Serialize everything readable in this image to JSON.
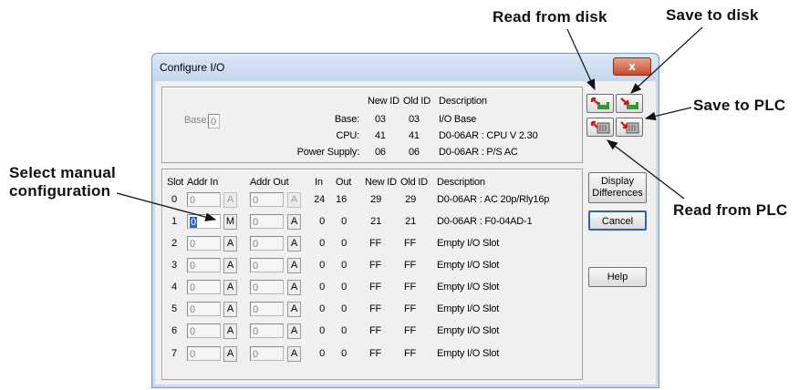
{
  "callouts": {
    "read_disk": "Read from disk",
    "save_disk": "Save to disk",
    "save_plc": "Save to PLC",
    "read_plc": "Read from PLC",
    "select_manual_1": "Select manual",
    "select_manual_2": "configuration"
  },
  "dialog": {
    "title": "Configure I/O",
    "close": "x",
    "base_label": "Base:",
    "base_value": "0",
    "header": {
      "new_id": "New ID",
      "old_id": "Old ID",
      "description": "Description"
    },
    "base_rows": [
      {
        "label": "Base:",
        "new_id": "03",
        "old_id": "03",
        "description": "I/O Base"
      },
      {
        "label": "CPU:",
        "new_id": "41",
        "old_id": "41",
        "description": "D0-06AR : CPU  V 2.30"
      },
      {
        "label": "Power Supply:",
        "new_id": "06",
        "old_id": "06",
        "description": "D0-06AR : P/S AC"
      }
    ],
    "slot_header": {
      "slot": "Slot",
      "addr_in": "Addr In",
      "addr_out": "Addr Out",
      "in": "In",
      "out": "Out",
      "new_id": "New ID",
      "old_id": "Old ID",
      "description": "Description"
    },
    "slots": [
      {
        "slot": "0",
        "addr_in": "0",
        "btn_in": "A",
        "addr_out": "0",
        "btn_out": "A",
        "in": "24",
        "out": "16",
        "new_id": "29",
        "old_id": "29",
        "description": "D0-06AR : AC 20p/Rly16p"
      },
      {
        "slot": "1",
        "addr_in": "0",
        "btn_in": "M",
        "addr_out": "0",
        "btn_out": "A",
        "in": "0",
        "out": "0",
        "new_id": "21",
        "old_id": "21",
        "description": "D0-06AR : F0-04AD-1"
      },
      {
        "slot": "2",
        "addr_in": "0",
        "btn_in": "A",
        "addr_out": "0",
        "btn_out": "A",
        "in": "0",
        "out": "0",
        "new_id": "FF",
        "old_id": "FF",
        "description": "Empty I/O Slot"
      },
      {
        "slot": "3",
        "addr_in": "0",
        "btn_in": "A",
        "addr_out": "0",
        "btn_out": "A",
        "in": "0",
        "out": "0",
        "new_id": "FF",
        "old_id": "FF",
        "description": "Empty I/O Slot"
      },
      {
        "slot": "4",
        "addr_in": "0",
        "btn_in": "A",
        "addr_out": "0",
        "btn_out": "A",
        "in": "0",
        "out": "0",
        "new_id": "FF",
        "old_id": "FF",
        "description": "Empty I/O Slot"
      },
      {
        "slot": "5",
        "addr_in": "0",
        "btn_in": "A",
        "addr_out": "0",
        "btn_out": "A",
        "in": "0",
        "out": "0",
        "new_id": "FF",
        "old_id": "FF",
        "description": "Empty I/O Slot"
      },
      {
        "slot": "6",
        "addr_in": "0",
        "btn_in": "A",
        "addr_out": "0",
        "btn_out": "A",
        "in": "0",
        "out": "0",
        "new_id": "FF",
        "old_id": "FF",
        "description": "Empty I/O Slot"
      },
      {
        "slot": "7",
        "addr_in": "0",
        "btn_in": "A",
        "addr_out": "0",
        "btn_out": "A",
        "in": "0",
        "out": "0",
        "new_id": "FF",
        "old_id": "FF",
        "description": "Empty I/O Slot"
      }
    ],
    "buttons": {
      "display_diff_1": "Display",
      "display_diff_2": "Differences",
      "cancel": "Cancel",
      "help": "Help"
    },
    "icons": [
      "read-from-disk-icon",
      "save-to-disk-icon",
      "read-from-plc-icon",
      "save-to-plc-icon"
    ],
    "colors": {
      "title_bar": "#c4d6ee",
      "close_button": "#c74b2b",
      "selection": "#2b63c8"
    }
  }
}
